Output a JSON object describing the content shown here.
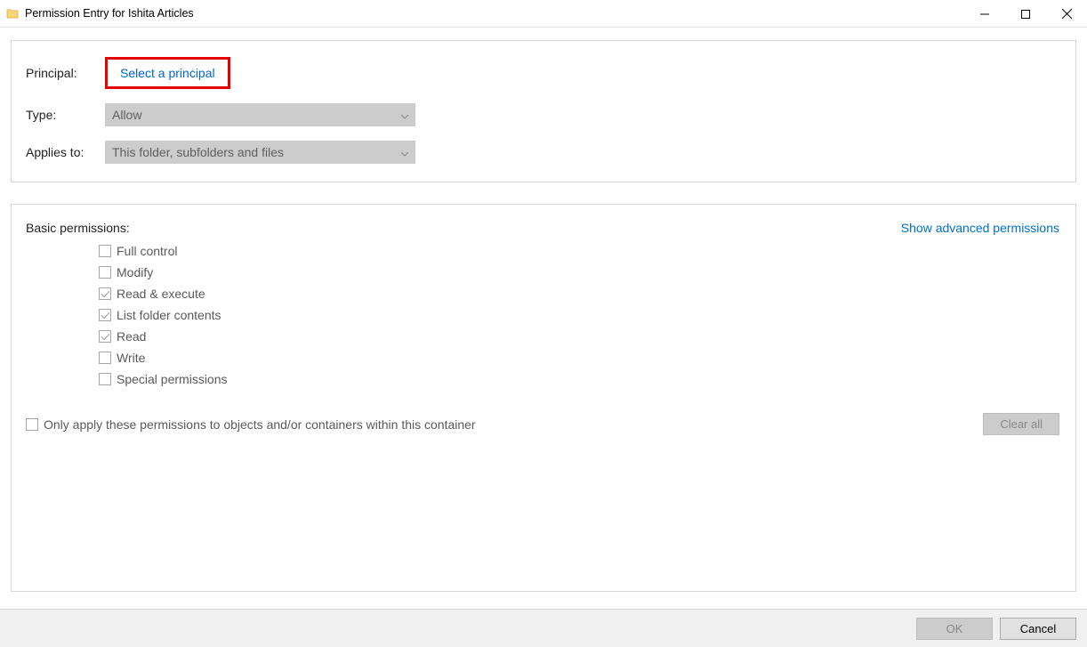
{
  "titlebar": {
    "title": "Permission Entry for Ishita Articles"
  },
  "principal": {
    "label": "Principal:",
    "link_text": "Select a principal"
  },
  "type": {
    "label": "Type:",
    "value": "Allow"
  },
  "applies_to": {
    "label": "Applies to:",
    "value": "This folder, subfolders and files"
  },
  "permissions": {
    "title": "Basic permissions:",
    "advanced_link": "Show advanced permissions",
    "items": [
      {
        "label": "Full control",
        "checked": false
      },
      {
        "label": "Modify",
        "checked": false
      },
      {
        "label": "Read & execute",
        "checked": true
      },
      {
        "label": "List folder contents",
        "checked": true
      },
      {
        "label": "Read",
        "checked": true
      },
      {
        "label": "Write",
        "checked": false
      },
      {
        "label": "Special permissions",
        "checked": false
      }
    ],
    "apply_only_label": "Only apply these permissions to objects and/or containers within this container",
    "clear_all_label": "Clear all"
  },
  "footer": {
    "ok_label": "OK",
    "cancel_label": "Cancel"
  }
}
